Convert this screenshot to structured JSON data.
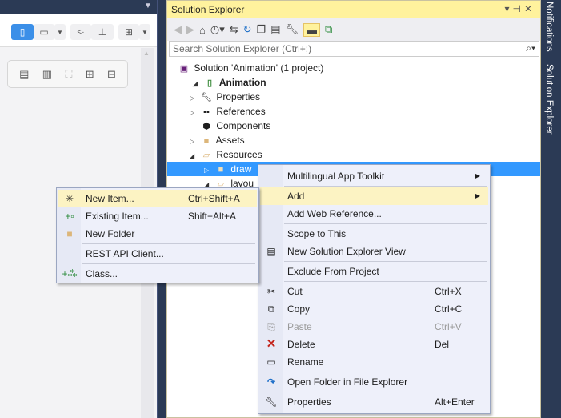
{
  "left_panel": {
    "toolbar_icons": [
      "phone-icon",
      "tablet-icon",
      "dropdown-icon",
      "back-icon",
      "brush-icon",
      "grid-icon",
      "dropdown-icon"
    ],
    "zoom_icons": [
      "layout-icon",
      "chart-icon",
      "fit-icon",
      "zoom-in-icon",
      "zoom-out-icon"
    ]
  },
  "solution_explorer": {
    "title": "Solution Explorer",
    "search_placeholder": "Search Solution Explorer (Ctrl+;)",
    "tree": [
      {
        "label": "Solution 'Animation' (1 project)"
      },
      {
        "label": "Animation"
      },
      {
        "label": "Properties"
      },
      {
        "label": "References"
      },
      {
        "label": "Components"
      },
      {
        "label": "Assets"
      },
      {
        "label": "Resources"
      },
      {
        "label": "draw"
      },
      {
        "label": "layou"
      }
    ]
  },
  "side_tabs": [
    "Notifications",
    "Solution Explorer"
  ],
  "context_menu": {
    "items": [
      {
        "label": "Multilingual App Toolkit",
        "shortcut": ""
      },
      {
        "label": "Add",
        "shortcut": ""
      },
      {
        "label": "Add Web Reference...",
        "shortcut": ""
      },
      {
        "label": "Scope to This",
        "shortcut": ""
      },
      {
        "label": "New Solution Explorer View",
        "shortcut": ""
      },
      {
        "label": "Exclude From Project",
        "shortcut": ""
      },
      {
        "label": "Cut",
        "shortcut": "Ctrl+X"
      },
      {
        "label": "Copy",
        "shortcut": "Ctrl+C"
      },
      {
        "label": "Paste",
        "shortcut": "Ctrl+V"
      },
      {
        "label": "Delete",
        "shortcut": "Del"
      },
      {
        "label": "Rename",
        "shortcut": ""
      },
      {
        "label": "Open Folder in File Explorer",
        "shortcut": ""
      },
      {
        "label": "Properties",
        "shortcut": "Alt+Enter"
      }
    ]
  },
  "add_submenu": {
    "items": [
      {
        "label": "New Item...",
        "shortcut": "Ctrl+Shift+A"
      },
      {
        "label": "Existing Item...",
        "shortcut": "Shift+Alt+A"
      },
      {
        "label": "New Folder",
        "shortcut": ""
      },
      {
        "label": "REST API Client...",
        "shortcut": ""
      },
      {
        "label": "Class...",
        "shortcut": ""
      }
    ]
  }
}
